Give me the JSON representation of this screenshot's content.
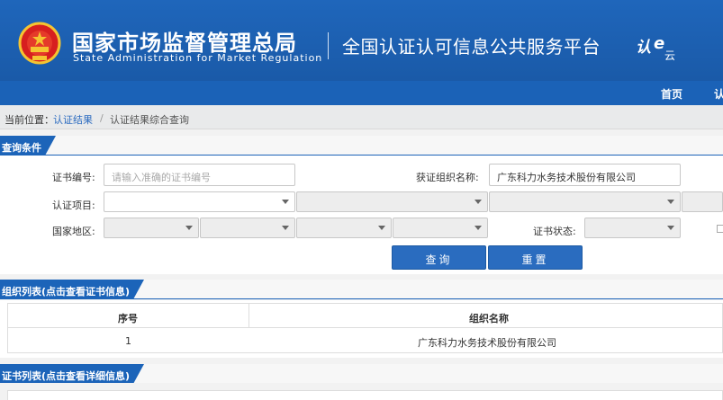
{
  "header": {
    "org_name_cn": "国家市场监督管理总局",
    "org_name_en": "State Administration for Market Regulation",
    "platform_title": "全国认证认可信息公共服务平台",
    "logo_text": "认e云"
  },
  "nav": {
    "home": "首页",
    "more": "认"
  },
  "breadcrumb": {
    "label": "当前位置：",
    "link": "认证结果",
    "separator": "/",
    "current": "认证结果综合查询"
  },
  "query": {
    "section_title": "查询条件",
    "cert_no_label": "证书编号:",
    "cert_no_placeholder": "请输入准确的证书编号",
    "org_name_label": "获证组织名称:",
    "org_name_value": "广东科力水务技术股份有限公司",
    "project_label": "认证项目:",
    "region_label": "国家地区:",
    "status_label": "证书状态:",
    "query_button": "查询",
    "reset_button": "重置"
  },
  "org_list": {
    "section_title": "组织列表(点击查看证书信息)",
    "columns": [
      "序号",
      "组织名称"
    ],
    "rows": [
      {
        "index": "1",
        "name": "广东科力水务技术股份有限公司"
      }
    ]
  },
  "cert_list": {
    "section_title": "证书列表(点击查看详细信息)"
  },
  "colors": {
    "header_blue": "#1f66bb",
    "nav_blue": "#1b62b7",
    "button_blue": "#2a6cbf",
    "link_blue": "#2d6cc0"
  }
}
